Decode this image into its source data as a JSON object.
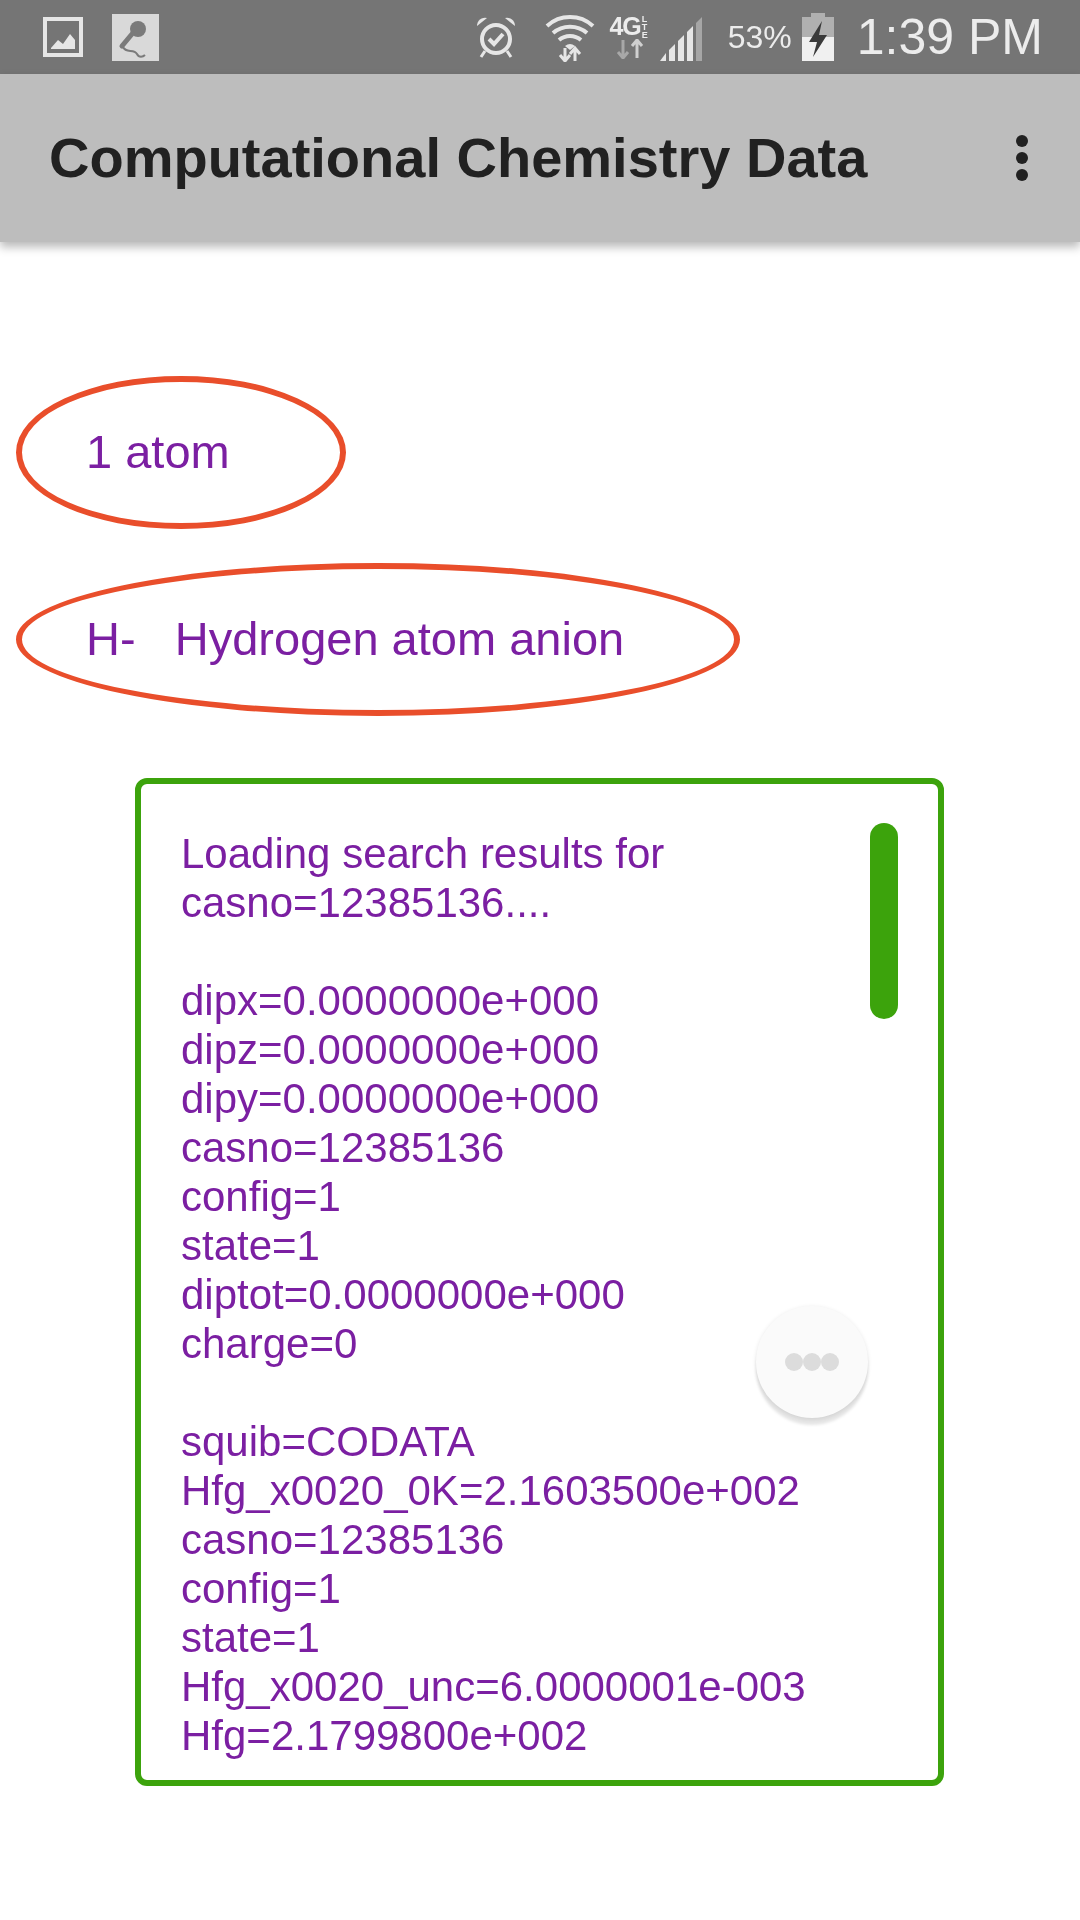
{
  "status_bar": {
    "network": "4G",
    "network_sub": "LTE",
    "battery": "53%",
    "time": "1:39 PM"
  },
  "app_bar": {
    "title": "Computational Chemistry Data"
  },
  "selections": [
    {
      "text": "1 atom",
      "circled": true
    },
    {
      "text": "H-   Hydrogen atom anion",
      "circled": true
    }
  ],
  "results": {
    "groups": [
      [
        "Loading search results for casno=12385136...."
      ],
      [
        "dipx=0.0000000e+000",
        "dipz=0.0000000e+000",
        "dipy=0.0000000e+000",
        "casno=12385136",
        "config=1",
        "state=1",
        "diptot=0.0000000e+000",
        "charge=0"
      ],
      [
        "squib=CODATA",
        "Hfg_x0020_0K=2.1603500e+002",
        "casno=12385136",
        "config=1",
        "state=1",
        "Hfg_x0020_unc=6.0000001e-003",
        "Hfg=2.1799800e+002"
      ]
    ]
  }
}
